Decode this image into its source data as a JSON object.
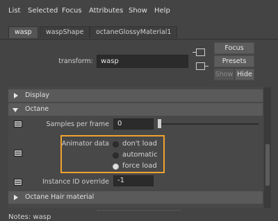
{
  "menu": {
    "items": [
      "List",
      "Selected",
      "Focus",
      "Attributes",
      "Show",
      "Help"
    ]
  },
  "tabs": [
    {
      "label": "wasp",
      "active": true
    },
    {
      "label": "waspShape",
      "active": false
    },
    {
      "label": "octaneGlossyMaterial1",
      "active": false
    }
  ],
  "transform": {
    "label": "transform:",
    "value": "wasp"
  },
  "buttons": {
    "focus": "Focus",
    "presets": "Presets",
    "show": "Show",
    "hide": "Hide"
  },
  "sections": {
    "display": "Display",
    "octane": "Octane",
    "hair": "Octane Hair material"
  },
  "attributes": {
    "samples_label": "Samples per frame",
    "samples_value": "0",
    "animator_label": "Animator data",
    "animator_options": [
      {
        "label": "don't load",
        "checked": false
      },
      {
        "label": "automatic",
        "checked": false
      },
      {
        "label": "force load",
        "checked": true
      }
    ],
    "instance_label": "Instance ID override",
    "instance_value": "-1"
  },
  "notes": {
    "label": "Notes: wasp"
  },
  "colors": {
    "highlight": "#f0a32f",
    "background": "#444444"
  },
  "icons": [
    "expand-right-icon",
    "expand-down-icon",
    "layer-icon",
    "input-connection-icon",
    "output-connection-icon"
  ]
}
